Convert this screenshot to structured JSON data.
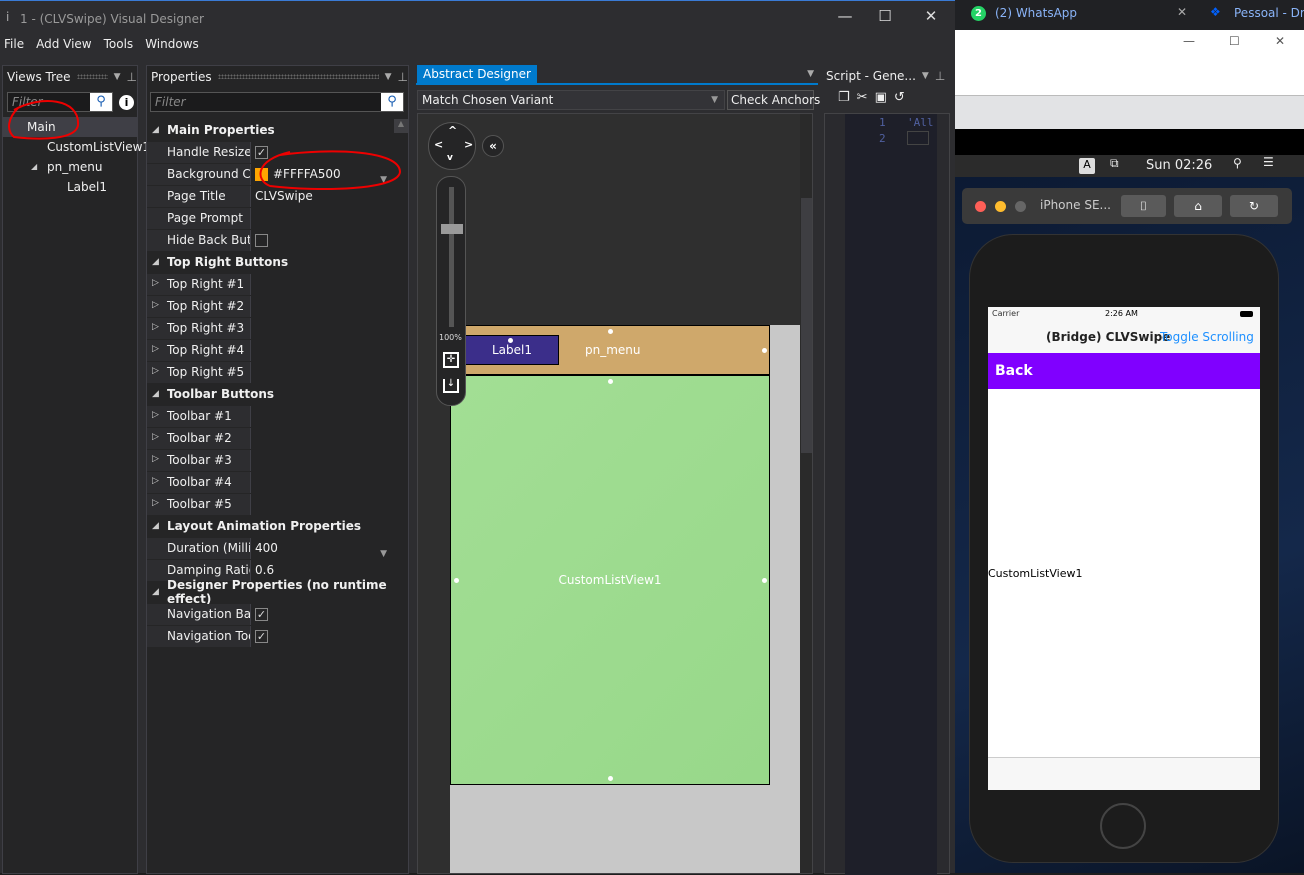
{
  "window": {
    "title": "1 - (CLVSwipe) Visual Designer",
    "minimize": "—",
    "maximize": "☐",
    "close": "✕"
  },
  "menu": [
    "File",
    "Add View",
    "Tools",
    "Windows"
  ],
  "views_tree": {
    "title": "Views Tree",
    "filter_placeholder": "Filter",
    "items": [
      {
        "label": "Main",
        "level": 0,
        "selected": true
      },
      {
        "label": "CustomListView1",
        "level": 1
      },
      {
        "label": "pn_menu",
        "level": 1,
        "expanded": true
      },
      {
        "label": "Label1",
        "level": 2
      }
    ]
  },
  "properties": {
    "title": "Properties",
    "filter_placeholder": "Filter",
    "rows": [
      {
        "type": "cat",
        "label": "Main Properties"
      },
      {
        "type": "prop",
        "label": "Handle Resize Ev...",
        "check": true
      },
      {
        "type": "prop",
        "label": "Background Color",
        "value": "#FFFFA500",
        "swatch": "#FFA500",
        "dropdown": true
      },
      {
        "type": "prop",
        "label": "Page Title",
        "value": "CLVSwipe"
      },
      {
        "type": "prop",
        "label": "Page Prompt",
        "value": ""
      },
      {
        "type": "prop",
        "label": "Hide Back Button",
        "check": false
      },
      {
        "type": "cat",
        "label": "Top Right Buttons"
      },
      {
        "type": "sub",
        "label": "Top Right #1"
      },
      {
        "type": "sub",
        "label": "Top Right #2"
      },
      {
        "type": "sub",
        "label": "Top Right #3"
      },
      {
        "type": "sub",
        "label": "Top Right #4"
      },
      {
        "type": "sub",
        "label": "Top Right #5"
      },
      {
        "type": "cat",
        "label": "Toolbar Buttons"
      },
      {
        "type": "sub",
        "label": "Toolbar #1"
      },
      {
        "type": "sub",
        "label": "Toolbar #2"
      },
      {
        "type": "sub",
        "label": "Toolbar #3"
      },
      {
        "type": "sub",
        "label": "Toolbar #4"
      },
      {
        "type": "sub",
        "label": "Toolbar #5"
      },
      {
        "type": "cat",
        "label": "Layout Animation Properties"
      },
      {
        "type": "prop",
        "label": "Duration (Millise...",
        "value": "400",
        "dropdown": true
      },
      {
        "type": "prop",
        "label": "Damping Ratio",
        "value": "0.6"
      },
      {
        "type": "cat",
        "label": "Designer Properties (no runtime effect)"
      },
      {
        "type": "prop",
        "label": "Navigation Bar Vi...",
        "check": true
      },
      {
        "type": "prop",
        "label": "Navigation Toolb...",
        "check": true
      }
    ]
  },
  "designer": {
    "tab": "Abstract Designer",
    "variant": "Match Chosen Variant",
    "check_anchors": "Check Anchors",
    "zoom": "100%",
    "zoom_fraction": 0.7,
    "panel_label": "pn_menu",
    "label1": "Label1",
    "listview": "CustomListView1",
    "colors": {
      "panel": "#CFA86B",
      "label": "#3B2E8A",
      "listview": "#9DDD8F"
    }
  },
  "script": {
    "title": "Script - Gene...",
    "lines": [
      {
        "n": "1",
        "text": "'All"
      },
      {
        "n": "2",
        "text": ""
      }
    ]
  },
  "browser": {
    "tabs": [
      {
        "label": "(2) WhatsApp",
        "badge": "2"
      },
      {
        "label": "Pessoal - Dro"
      }
    ]
  },
  "mac": {
    "clock": "Sun 02:26",
    "input": "A"
  },
  "simulator": {
    "device": "iPhone SE...",
    "status": {
      "carrier": "Carrier",
      "time": "2:26 AM"
    },
    "nav_title": "(Bridge) CLVSwipe",
    "nav_button": "Toggle Scrolling",
    "back": "Back",
    "listview": "CustomListView1",
    "back_color": "#8000FF",
    "link_color": "#1E90FF"
  }
}
